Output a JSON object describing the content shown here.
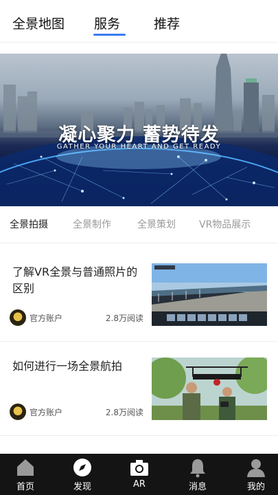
{
  "top_tabs": [
    {
      "label": "全景地图"
    },
    {
      "label": "服务"
    },
    {
      "label": "推荐"
    }
  ],
  "active_top_tab": "服务",
  "accent_color": "#3a7cf2",
  "banner": {
    "title": "凝心聚力 蓄势待发",
    "subtitle": "GATHER YOUR HEART AND GET READY"
  },
  "category_tabs": [
    {
      "label": "全景拍摄"
    },
    {
      "label": "全景制作"
    },
    {
      "label": "全景策划"
    },
    {
      "label": "VR物品展示"
    }
  ],
  "active_category": "全景拍摄",
  "articles": [
    {
      "title": "了解VR全景与普通照片的区别",
      "author": "官方账户",
      "reads": "2.8万阅读"
    },
    {
      "title": "如何进行一场全景航拍",
      "author": "官方账户",
      "reads": "2.8万阅读"
    }
  ],
  "bottom_nav": [
    {
      "label": "首页",
      "icon": "home-icon"
    },
    {
      "label": "发现",
      "icon": "compass-icon"
    },
    {
      "label": "AR",
      "icon": "camera-icon"
    },
    {
      "label": "消息",
      "icon": "bell-icon"
    },
    {
      "label": "我的",
      "icon": "user-icon"
    }
  ]
}
